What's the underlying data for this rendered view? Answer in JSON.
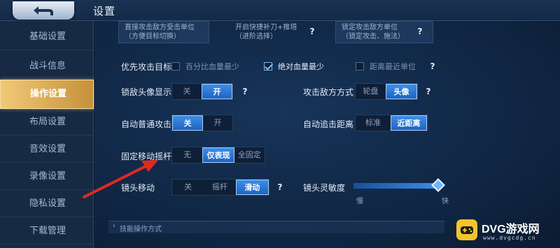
{
  "header": {
    "title": "设置"
  },
  "sidebar": {
    "items": [
      {
        "label": "基础设置"
      },
      {
        "label": "战斗信息"
      },
      {
        "label": "操作设置"
      },
      {
        "label": "布局设置"
      },
      {
        "label": "音效设置"
      },
      {
        "label": "录像设置"
      },
      {
        "label": "隐私设置"
      },
      {
        "label": "下载管理"
      }
    ],
    "active_index": 2
  },
  "top_cards": [
    {
      "line1": "直接攻击敌方受击单位",
      "line2": "（方便目标切换）"
    },
    {
      "line1": "开启快捷补刀+推塔",
      "line2": "（进阶选择）"
    },
    {
      "line1": "锁定攻击敌方单位",
      "line2": "（锁定攻击、施法）"
    }
  ],
  "priority": {
    "label": "优先攻击目标",
    "options": [
      {
        "text": "百分比血量最少",
        "checked": false
      },
      {
        "text": "绝对血量最少",
        "checked": true
      },
      {
        "text": "距离最近单位",
        "checked": false
      }
    ]
  },
  "lock_avatar": {
    "label": "锁敌头像显示",
    "options": [
      "关",
      "开"
    ],
    "selected": "开"
  },
  "attack_mode": {
    "label": "攻击敌方方式",
    "options": [
      "轮盘",
      "头像"
    ],
    "selected": "头像"
  },
  "auto_attack": {
    "label": "自动普通攻击",
    "options": [
      "关",
      "开"
    ],
    "selected": "关"
  },
  "auto_chase": {
    "label": "自动追击距离",
    "options": [
      "标准",
      "近距离"
    ],
    "selected": "近距离"
  },
  "fixed_joystick": {
    "label": "固定移动摇杆",
    "options": [
      "无",
      "仅表现",
      "全固定"
    ],
    "selected": "仅表现"
  },
  "camera_move": {
    "label": "镜头移动",
    "options": [
      "关",
      "摇杆",
      "滑动"
    ],
    "selected": "滑动"
  },
  "camera_sensitivity": {
    "label": "镜头灵敏度",
    "min_label": "慢",
    "max_label": "快",
    "level": 1.0
  },
  "skill_section": {
    "title": "技能操作方式"
  },
  "help": {
    "symbol": "?"
  },
  "watermark": {
    "brand": "DVG游戏网",
    "url": "www.dvgcdg.cn"
  },
  "colors": {
    "accent": "#2f7fd8",
    "active_tab": "#e5b661",
    "arrow": "#e02a1e"
  }
}
